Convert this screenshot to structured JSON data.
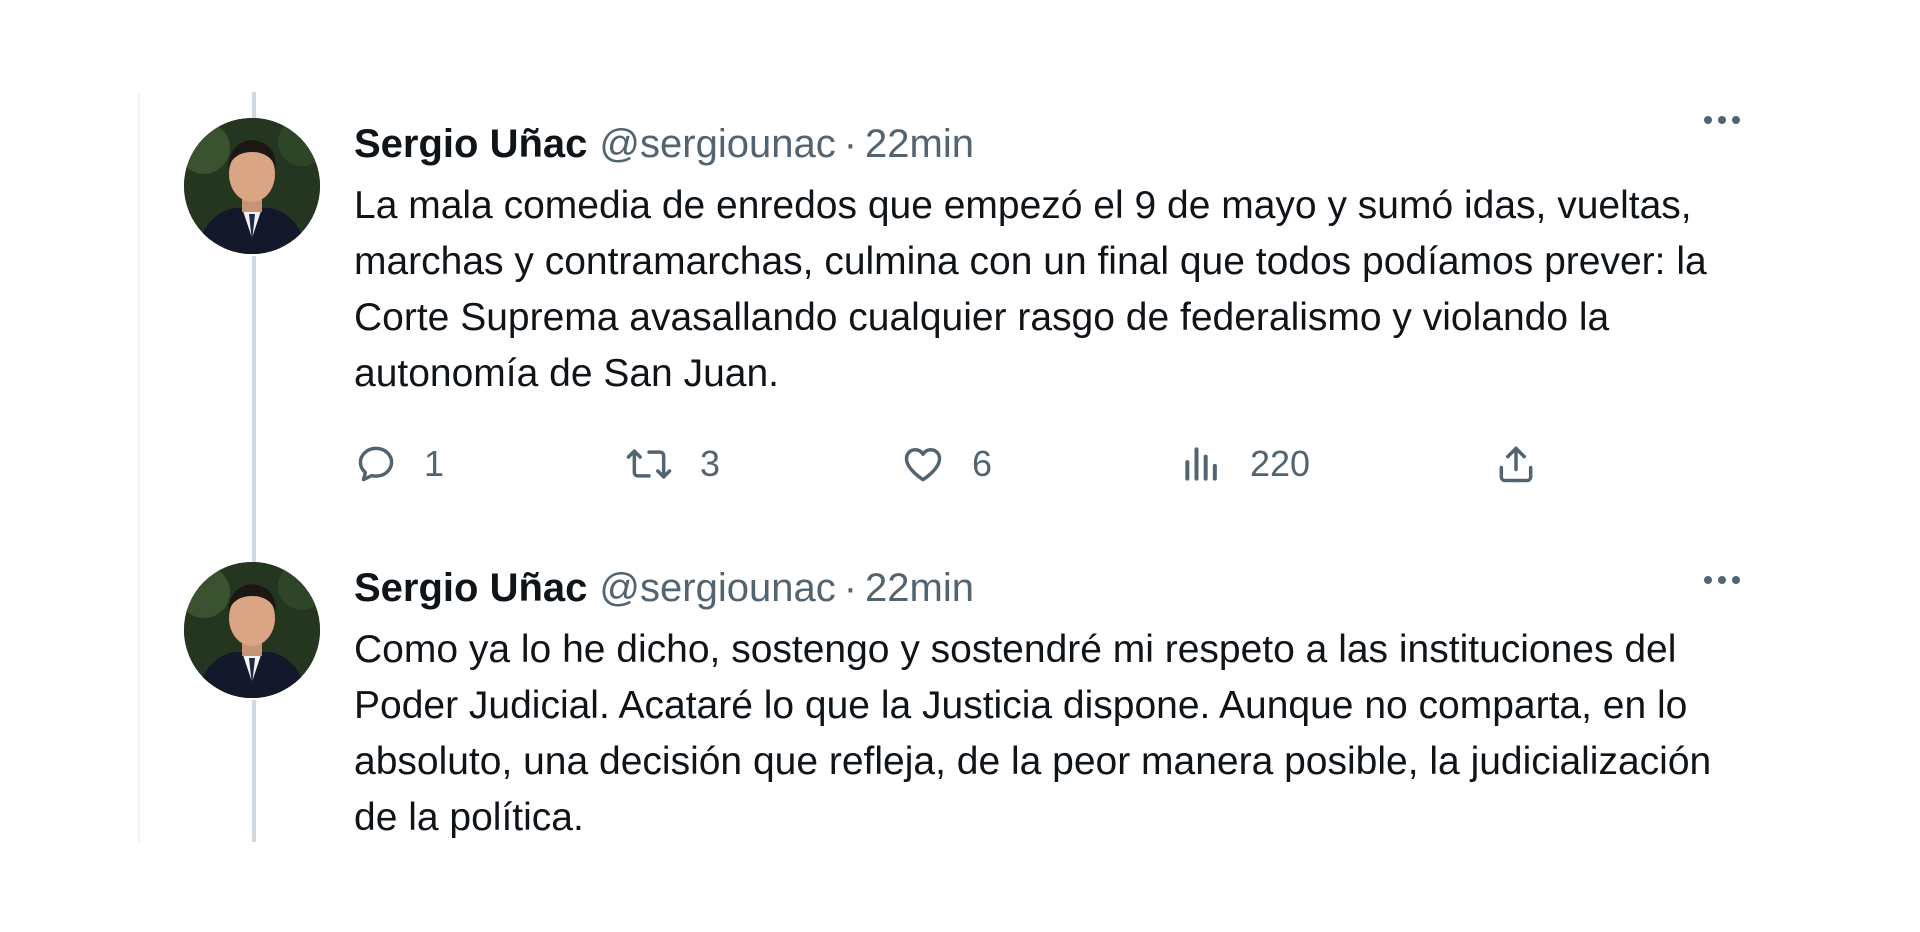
{
  "tweets": [
    {
      "author": {
        "name": "Sergio Uñac",
        "handle": "@sergiounac",
        "separator": "·",
        "time": "22min"
      },
      "text": "La mala comedia de enredos que empezó el 9 de mayo y sumó idas, vueltas, marchas y contramarchas, culmina con un final que todos podíamos prever: la Corte Suprema avasallando cualquier rasgo de federalismo y violando la autonomía de San Juan.",
      "stats": {
        "replies": "1",
        "retweets": "3",
        "likes": "6",
        "views": "220"
      }
    },
    {
      "author": {
        "name": "Sergio Uñac",
        "handle": "@sergiounac",
        "separator": "·",
        "time": "22min"
      },
      "text": "Como ya lo he dicho, sostengo y sostendré mi respeto a las instituciones del Poder Judicial. Acataré lo que la Justicia dispone. Aunque no comparta, en lo absoluto, una decisión que refleja, de la peor manera posible, la judicialización de la política."
    }
  ],
  "icons": {
    "more": "more-horizontal-icon",
    "reply": "reply-bubble-icon",
    "retweet": "retweet-icon",
    "like": "heart-icon",
    "views": "views-chart-icon",
    "share": "share-upload-icon"
  },
  "colors": {
    "text": "#0f1419",
    "secondary": "#536471",
    "thread_line": "#cfd9de"
  }
}
